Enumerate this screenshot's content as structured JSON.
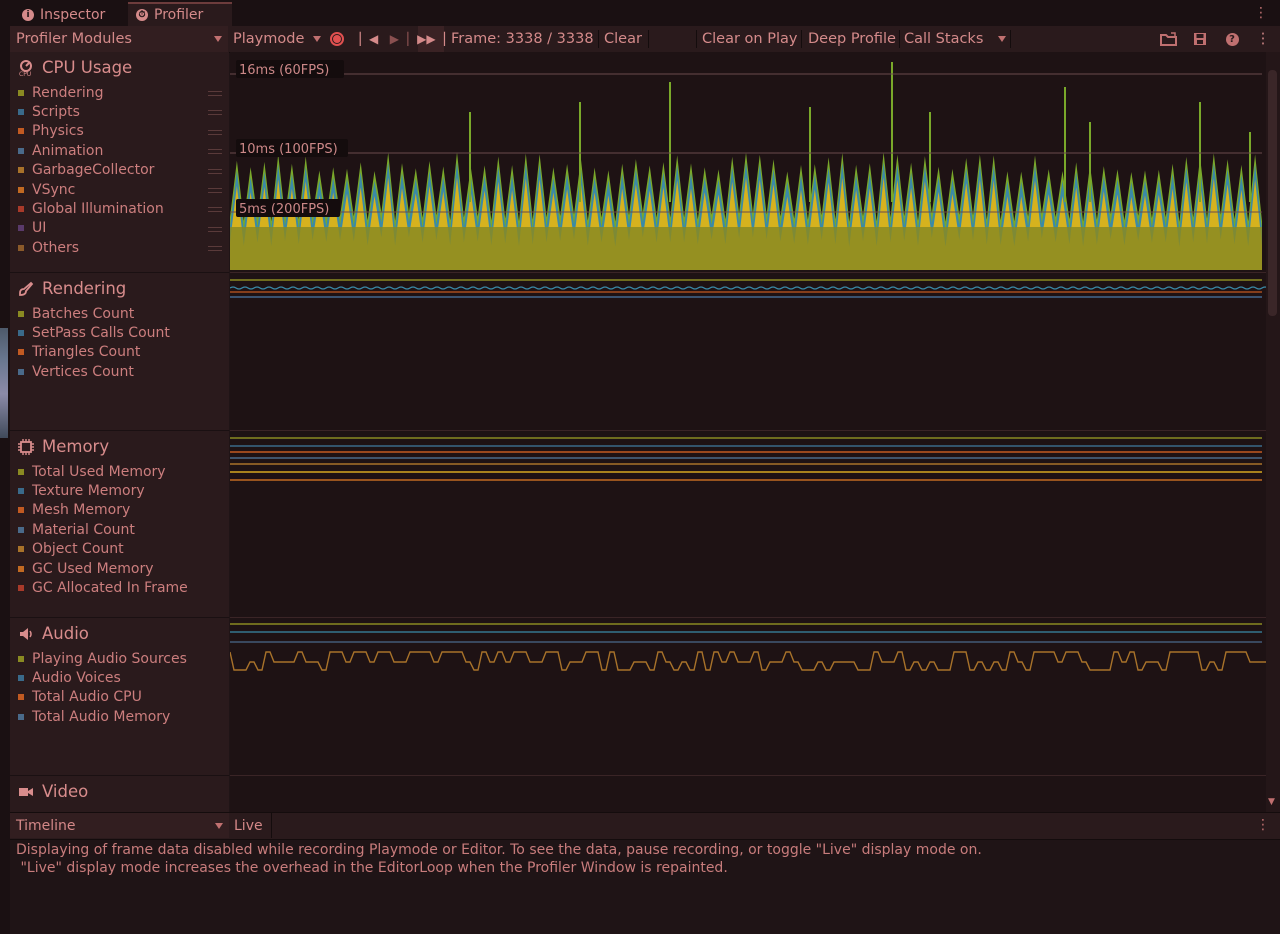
{
  "tabs": {
    "inspector": "Inspector",
    "profiler": "Profiler"
  },
  "toolbar": {
    "modules_dropdown": "Profiler Modules",
    "playmode_dropdown": "Playmode",
    "frame_label": "Frame: 3338 / 3338",
    "clear": "Clear",
    "clear_on_play": "Clear on Play",
    "deep_profile": "Deep Profile",
    "call_stacks": "Call Stacks"
  },
  "modules": {
    "cpu": {
      "title": "CPU Usage",
      "items": [
        {
          "label": "Rendering",
          "color": "#8a8a22"
        },
        {
          "label": "Scripts",
          "color": "#3a6a8a"
        },
        {
          "label": "Physics",
          "color": "#c25a22"
        },
        {
          "label": "Animation",
          "color": "#4a6a8a"
        },
        {
          "label": "GarbageCollector",
          "color": "#a8722a"
        },
        {
          "label": "VSync",
          "color": "#c26a22"
        },
        {
          "label": "Global Illumination",
          "color": "#a83a2a"
        },
        {
          "label": "UI",
          "color": "#5a3a6a"
        },
        {
          "label": "Others",
          "color": "#8a5a2a"
        }
      ],
      "markers": [
        "16ms (60FPS)",
        "10ms (100FPS)",
        "5ms (200FPS)"
      ]
    },
    "rendering": {
      "title": "Rendering",
      "items": [
        {
          "label": "Batches Count",
          "color": "#8a8a22"
        },
        {
          "label": "SetPass Calls Count",
          "color": "#3a6a8a"
        },
        {
          "label": "Triangles Count",
          "color": "#c25a22"
        },
        {
          "label": "Vertices Count",
          "color": "#4a6a8a"
        }
      ]
    },
    "memory": {
      "title": "Memory",
      "items": [
        {
          "label": "Total Used Memory",
          "color": "#8a8a22"
        },
        {
          "label": "Texture Memory",
          "color": "#3a6a8a"
        },
        {
          "label": "Mesh Memory",
          "color": "#c25a22"
        },
        {
          "label": "Material Count",
          "color": "#4a6a8a"
        },
        {
          "label": "Object Count",
          "color": "#a8722a"
        },
        {
          "label": "GC Used Memory",
          "color": "#c26a22"
        },
        {
          "label": "GC Allocated In Frame",
          "color": "#a83a2a"
        }
      ]
    },
    "audio": {
      "title": "Audio",
      "items": [
        {
          "label": "Playing Audio Sources",
          "color": "#8a8a22"
        },
        {
          "label": "Audio Voices",
          "color": "#3a6a8a"
        },
        {
          "label": "Total Audio CPU",
          "color": "#c25a22"
        },
        {
          "label": "Total Audio Memory",
          "color": "#4a6a8a"
        }
      ]
    },
    "video": {
      "title": "Video"
    }
  },
  "bottom": {
    "timeline_dropdown": "Timeline",
    "live_button": "Live",
    "message_line1": "Displaying of frame data disabled while recording Playmode or Editor. To see the data, pause recording, or toggle \"Live\" display mode on.",
    "message_line2": " \"Live\" display mode increases the overhead in the EditorLoop when the Profiler Window is repainted."
  },
  "colors": {
    "rendering_fill": "#8a8a22",
    "scripts": "#3a8aa8",
    "physics_yellow": "#d6b21e",
    "green": "#7aa82a",
    "audio_line": "#a8722a"
  }
}
